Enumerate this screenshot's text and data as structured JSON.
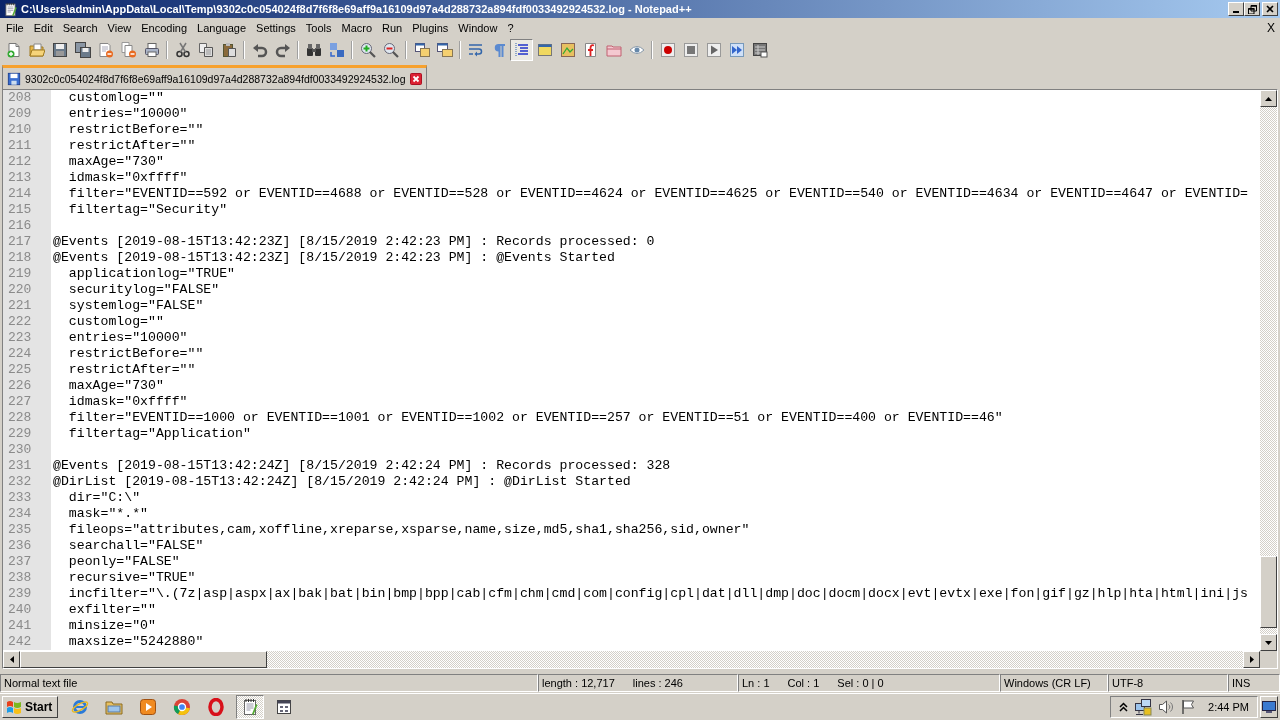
{
  "window": {
    "title": "C:\\Users\\admin\\AppData\\Local\\Temp\\9302c0c054024f8d7f6f8e69aff9a16109d97a4d288732a894fdf0033492924532.log - Notepad++"
  },
  "menu": {
    "items": [
      "File",
      "Edit",
      "Search",
      "View",
      "Encoding",
      "Language",
      "Settings",
      "Tools",
      "Macro",
      "Run",
      "Plugins",
      "Window",
      "?"
    ],
    "close": "X"
  },
  "toolbar": [
    {
      "on": false
    },
    {
      "on": false
    },
    {
      "on": false
    },
    {
      "on": false
    },
    {
      "on": false
    },
    {
      "on": false
    },
    {
      "on": false
    },
    {
      "on": false
    },
    {
      "on": false
    },
    {
      "on": false
    },
    {
      "on": false
    },
    {
      "on": false
    },
    {
      "on": false
    },
    {
      "on": false
    },
    {
      "on": false
    },
    {
      "on": false
    },
    {
      "on": false
    },
    {
      "on": false
    },
    {
      "on": false
    },
    {
      "on": false
    },
    {
      "on": true
    },
    {
      "on": false
    },
    {
      "on": false
    },
    {
      "on": false
    },
    {
      "on": false
    },
    {
      "on": false
    },
    {
      "on": false
    },
    {
      "on": false
    },
    {
      "on": false
    },
    {
      "on": false
    },
    {
      "on": false
    }
  ],
  "tabs": [
    {
      "label": "9302c0c054024f8d7f6f8e69aff9a16109d97a4d288732a894fdf0033492924532.log",
      "selected": true
    }
  ],
  "editor": {
    "lines": [
      {
        "number": "208",
        "text": "  customlog=\"\""
      },
      {
        "number": "209",
        "text": "  entries=\"10000\""
      },
      {
        "number": "210",
        "text": "  restrictBefore=\"\""
      },
      {
        "number": "211",
        "text": "  restrictAfter=\"\""
      },
      {
        "number": "212",
        "text": "  maxAge=\"730\""
      },
      {
        "number": "213",
        "text": "  idmask=\"0xffff\""
      },
      {
        "number": "214",
        "text": "  filter=\"EVENTID==592 or EVENTID==4688 or EVENTID==528 or EVENTID==4624 or EVENTID==4625 or EVENTID==540 or EVENTID==4634 or EVENTID==4647 or EVENTID="
      },
      {
        "number": "215",
        "text": "  filtertag=\"Security\""
      },
      {
        "number": "216"
      },
      {
        "number": "217",
        "text": "@Events [2019-08-15T13:42:23Z] [8/15/2019 2:42:23 PM] : Records processed: 0"
      },
      {
        "number": "218",
        "text": "@Events [2019-08-15T13:42:23Z] [8/15/2019 2:42:23 PM] : @Events Started"
      },
      {
        "number": "219",
        "text": "  applicationlog=\"TRUE\""
      },
      {
        "number": "220",
        "text": "  securitylog=\"FALSE\""
      },
      {
        "number": "221",
        "text": "  systemlog=\"FALSE\""
      },
      {
        "number": "222",
        "text": "  customlog=\"\""
      },
      {
        "number": "223",
        "text": "  entries=\"10000\""
      },
      {
        "number": "224",
        "text": "  restrictBefore=\"\""
      },
      {
        "number": "225",
        "text": "  restrictAfter=\"\""
      },
      {
        "number": "226",
        "text": "  maxAge=\"730\""
      },
      {
        "number": "227",
        "text": "  idmask=\"0xffff\""
      },
      {
        "number": "228",
        "text": "  filter=\"EVENTID==1000 or EVENTID==1001 or EVENTID==1002 or EVENTID==257 or EVENTID==51 or EVENTID==400 or EVENTID==46\""
      },
      {
        "number": "229",
        "text": "  filtertag=\"Application\""
      },
      {
        "number": "230"
      },
      {
        "number": "231",
        "text": "@Events [2019-08-15T13:42:24Z] [8/15/2019 2:42:24 PM] : Records processed: 328"
      },
      {
        "number": "232",
        "text": "@DirList [2019-08-15T13:42:24Z] [8/15/2019 2:42:24 PM] : @DirList Started"
      },
      {
        "number": "233",
        "text": "  dir=\"C:\\\""
      },
      {
        "number": "234",
        "text": "  mask=\"*.*\""
      },
      {
        "number": "235",
        "text": "  fileops=\"attributes,cam,xoffline,xreparse,xsparse,name,size,md5,sha1,sha256,sid,owner\""
      },
      {
        "number": "236",
        "text": "  searchall=\"FALSE\""
      },
      {
        "number": "237",
        "text": "  peonly=\"FALSE\""
      },
      {
        "number": "238",
        "text": "  recursive=\"TRUE\""
      },
      {
        "number": "239",
        "text": "  incfilter=\"\\.(7z|asp|aspx|ax|bak|bat|bin|bmp|bpp|cab|cfm|chm|cmd|com|config|cpl|dat|dll|dmp|doc|docm|docx|evt|evtx|exe|fon|gif|gz|hlp|hta|html|ini|js"
      },
      {
        "number": "240",
        "text": "  exfilter=\"\""
      },
      {
        "number": "241",
        "text": "  minsize=\"0\""
      },
      {
        "number": "242",
        "text": "  maxsize=\"5242880\""
      }
    ]
  },
  "status_bar": {
    "file_type": "Normal text file",
    "length": "length : 12,717",
    "lines": "lines : 246",
    "line": "Ln : 1",
    "column": "Col : 1",
    "selection": "Sel : 0 | 0",
    "eol": "Windows (CR LF)",
    "encoding": "UTF-8",
    "mode": "INS"
  },
  "taskbar": {
    "start": "Start",
    "apps": [
      {
        "selected": false
      },
      {
        "selected": false
      },
      {
        "selected": false
      },
      {
        "selected": false
      },
      {
        "selected": false
      },
      {
        "selected": true
      },
      {
        "selected": false
      }
    ],
    "clock": "2:44 PM"
  }
}
